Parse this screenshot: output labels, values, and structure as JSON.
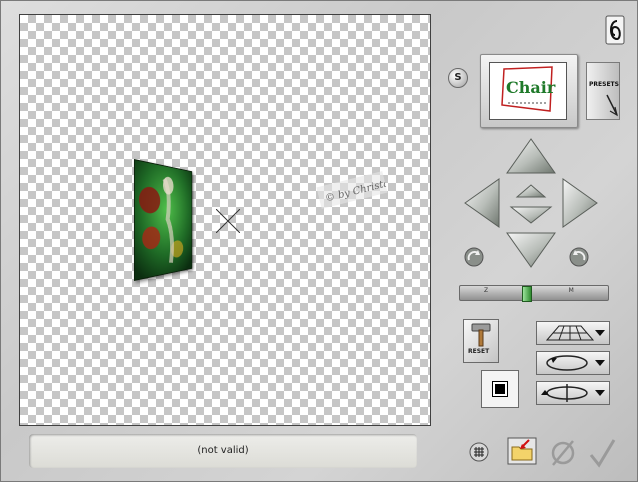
{
  "status": {
    "text": "(not valid)"
  },
  "preview": {
    "thumbnail_text": "Chair"
  },
  "presets": {
    "label": "PRESETS"
  },
  "s_button": {
    "label": "S"
  },
  "zoom": {
    "letters": "Z O M",
    "level": 0.45
  },
  "reset": {
    "label": "RESET"
  },
  "watermark": {
    "text": "© by Christa"
  },
  "colors": {
    "canvas_dark": "#c6c6c6",
    "canvas_light": "#ffffff",
    "image_green": "#1f6b26",
    "zoom_thumb": "#2f8a2f"
  }
}
